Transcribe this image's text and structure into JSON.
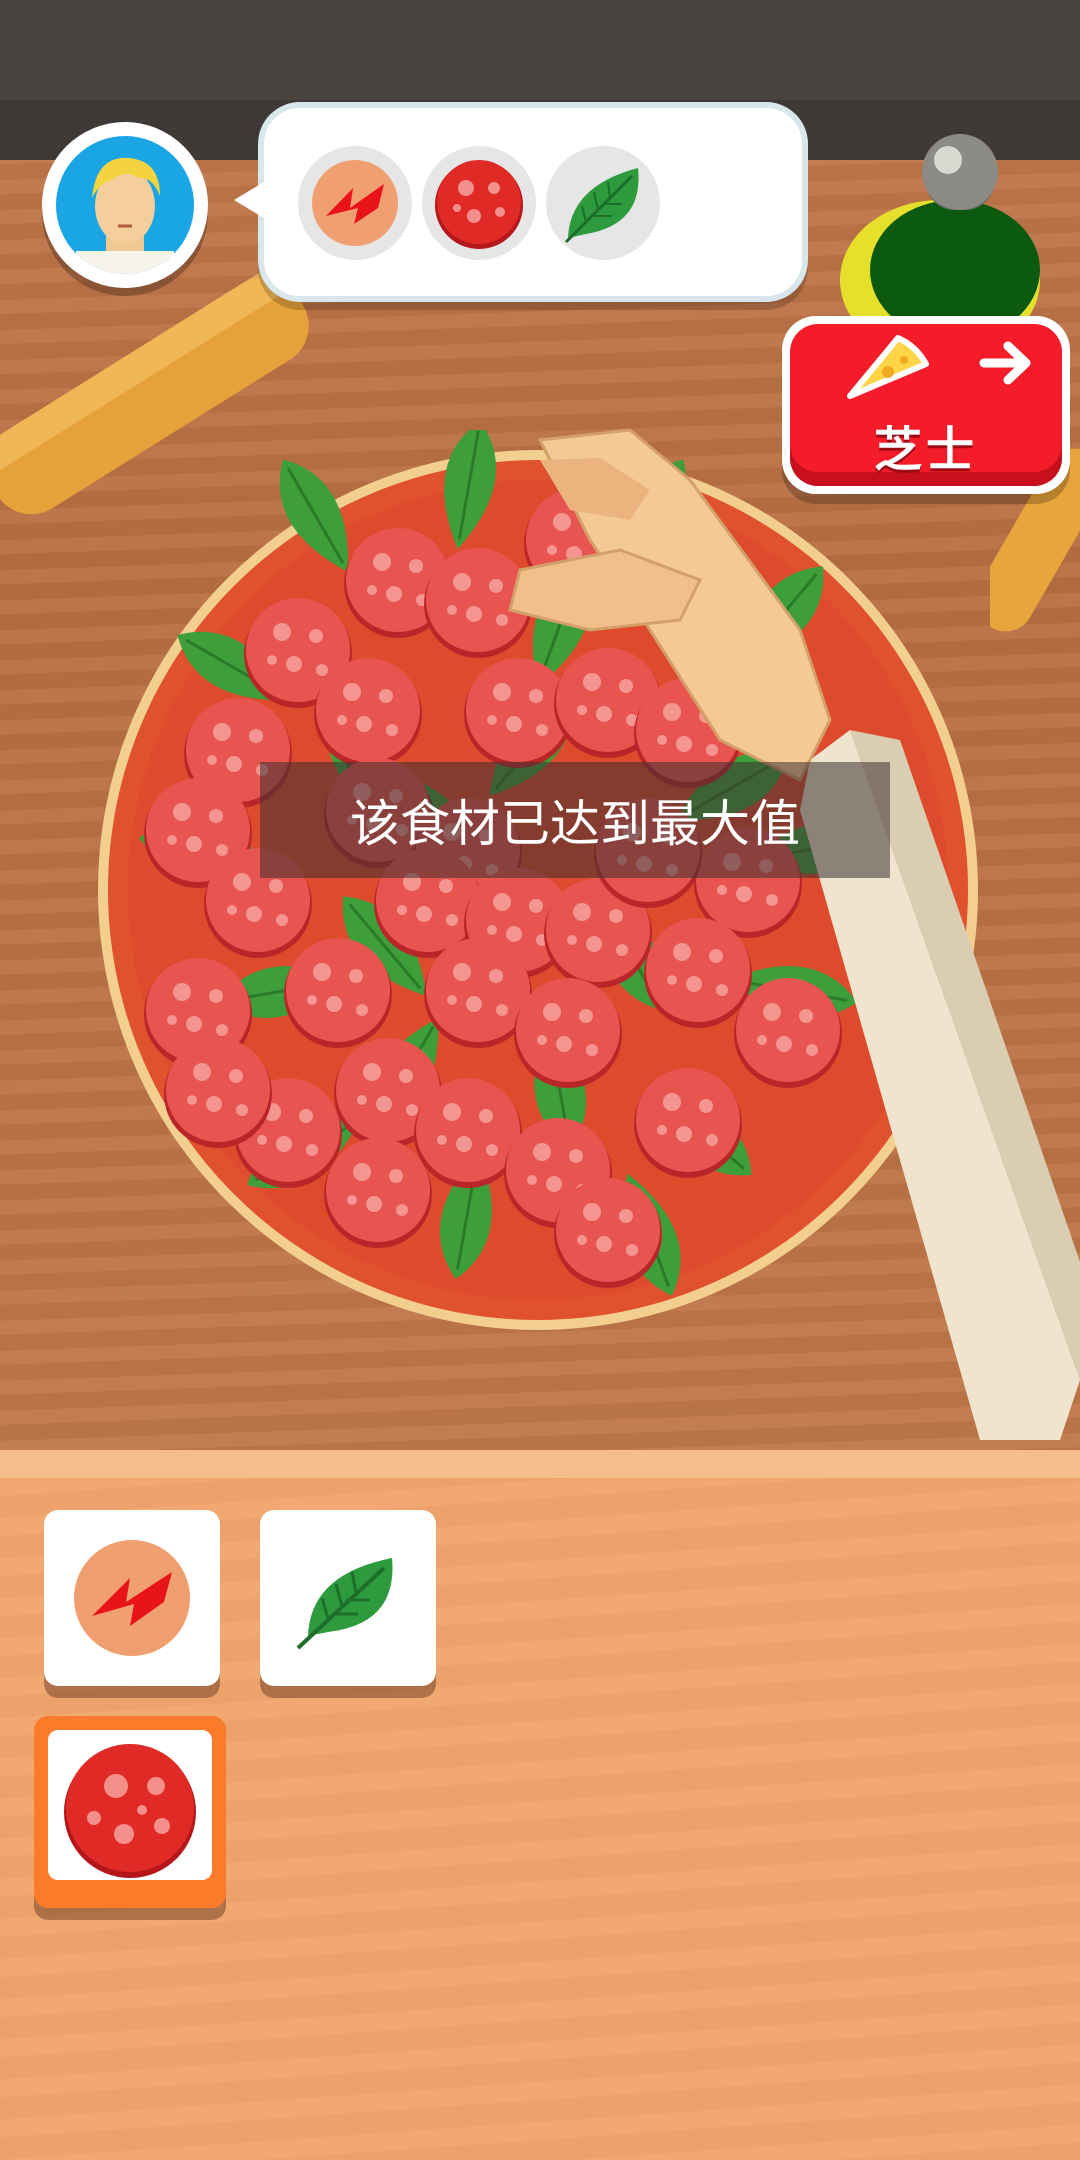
{
  "order": {
    "customer": "customer-avatar",
    "requested_ingredients": [
      {
        "name": "sauce-icon"
      },
      {
        "name": "pepperoni-icon"
      },
      {
        "name": "basil-icon"
      }
    ]
  },
  "next_button": {
    "label": "芝士",
    "icons": [
      "cheese-slice-icon",
      "arrow-right-icon"
    ]
  },
  "toast": {
    "message": "该食材已达到最大值"
  },
  "ingredient_tray": {
    "items": [
      {
        "name": "sauce",
        "selected": false
      },
      {
        "name": "basil",
        "selected": false
      },
      {
        "name": "pepperoni",
        "selected": true
      }
    ]
  },
  "colors": {
    "accent_red": "#f51c2a",
    "selection_orange": "#fa7b2a",
    "tray": "#f2a66c"
  }
}
